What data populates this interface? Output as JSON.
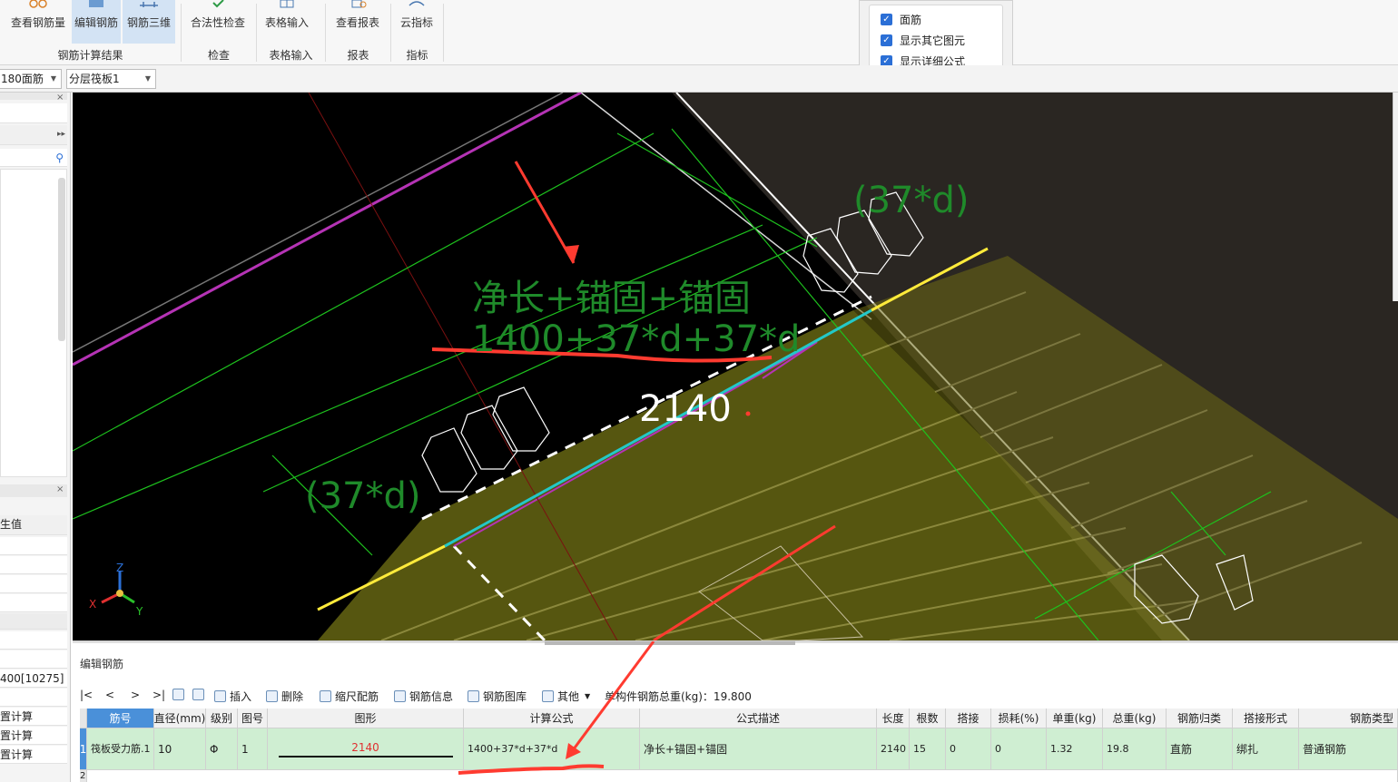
{
  "ribbon": {
    "buttons": [
      {
        "label": "查看钢筋量",
        "icon": "glasses-icon"
      },
      {
        "label": "编辑钢筋",
        "icon": "edit-rebar-icon",
        "active": true
      },
      {
        "label": "钢筋三维",
        "icon": "rebar-3d-icon",
        "active": true
      },
      {
        "label": "合法性检查",
        "icon": "check-icon"
      },
      {
        "label": "表格输入",
        "icon": "table-icon"
      },
      {
        "label": "查看报表",
        "icon": "report-icon"
      },
      {
        "label": "云指标",
        "icon": "cloud-icon"
      }
    ],
    "groups": [
      "钢筋计算结果",
      "检查",
      "表格输入",
      "报表",
      "指标"
    ]
  },
  "display_options": {
    "items": [
      {
        "label": "面筋",
        "checked": true
      },
      {
        "label": "显示其它图元",
        "checked": true
      },
      {
        "label": "显示详细公式",
        "checked": true
      }
    ]
  },
  "toolbar": {
    "combo1": "180面筋",
    "combo2": "分层筏板1"
  },
  "left_panel": {
    "attr_header": "生值",
    "value_row": "400[10275]",
    "calc_rows": [
      "置计算",
      "置计算",
      "置计算"
    ]
  },
  "viewport": {
    "annotation_title": "净长+锚固+锚固",
    "annotation_formula": "1400+37*d+37*d",
    "length_label": "2140",
    "anchor_label_top": "(37*d)",
    "anchor_label_left": "(37*d)",
    "axes": {
      "z": "Z",
      "x": "X",
      "y": "Y"
    },
    "colors": {
      "annotation": "#1f8a2a",
      "arrow": "#ff3b30",
      "slab": "#8a8a1a",
      "rebar": "#ffeb3b"
    }
  },
  "edit_panel": {
    "title": "编辑钢筋",
    "nav": [
      "|<",
      "<",
      ">",
      ">|"
    ],
    "tools": [
      {
        "label": "插入",
        "icon": "insert-icon"
      },
      {
        "label": "删除",
        "icon": "delete-icon"
      },
      {
        "label": "缩尺配筋",
        "icon": "scale-rebar-icon"
      },
      {
        "label": "钢筋信息",
        "icon": "rebar-info-icon"
      },
      {
        "label": "钢筋图库",
        "icon": "rebar-library-icon"
      },
      {
        "label": "其他",
        "icon": "other-icon"
      }
    ],
    "total_weight": "单构件钢筋总重(kg)：19.800",
    "columns": [
      "筋号",
      "直径(mm)",
      "级别",
      "图号",
      "图形",
      "计算公式",
      "公式描述",
      "长度",
      "根数",
      "搭接",
      "损耗(%)",
      "单重(kg)",
      "总重(kg)",
      "钢筋归类",
      "搭接形式",
      "钢筋类型"
    ],
    "rows": [
      {
        "index": "1",
        "name": "筏板受力筋.1",
        "diameter": "10",
        "grade": "Φ",
        "figure_no": "1",
        "shape_value": "2140",
        "formula": "1400+37*d+37*d",
        "description": "净长+锚固+锚固",
        "length": "2140",
        "count": "15",
        "lap": "0",
        "loss": "0",
        "unit_weight": "1.32",
        "total_weight": "19.8",
        "category": "直筋",
        "lap_type": "绑扎",
        "rebar_type": "普通钢筋"
      }
    ],
    "row2_index": "2"
  }
}
